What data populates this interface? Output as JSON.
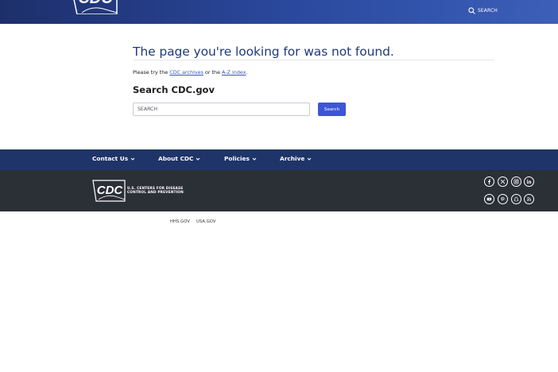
{
  "header": {
    "search_label": "SEARCH"
  },
  "main": {
    "title": "The page you're looking for was not found.",
    "help": {
      "prefix": "Please try the ",
      "link1": "CDC archives",
      "middle": " or the ",
      "link2": "A-Z index",
      "suffix": "."
    },
    "search_heading": "Search CDC.gov",
    "search_placeholder": "SEARCH",
    "search_button": "Search"
  },
  "footer_nav": {
    "items": [
      {
        "label": "Contact Us"
      },
      {
        "label": "About CDC"
      },
      {
        "label": "Policies"
      },
      {
        "label": "Archive"
      }
    ]
  },
  "footer": {
    "logo_text_line1": "U.S. CENTERS FOR DISEASE",
    "logo_text_line2": "CONTROL AND PREVENTION",
    "social": [
      "facebook-icon",
      "x-icon",
      "instagram-icon",
      "linkedin-icon",
      "youtube-icon",
      "pinterest-icon",
      "snapchat-icon",
      "rss-icon"
    ]
  },
  "bottom_links": [
    {
      "label": "HHS.GOV"
    },
    {
      "label": "USA.GOV"
    }
  ],
  "colors": {
    "header_start": "#1d2f6b",
    "header_end": "#3c5fb8",
    "title": "#1f3a7d",
    "button": "#3d56d7",
    "footer_nav": "#1f3468",
    "footer": "#2b2f36"
  }
}
